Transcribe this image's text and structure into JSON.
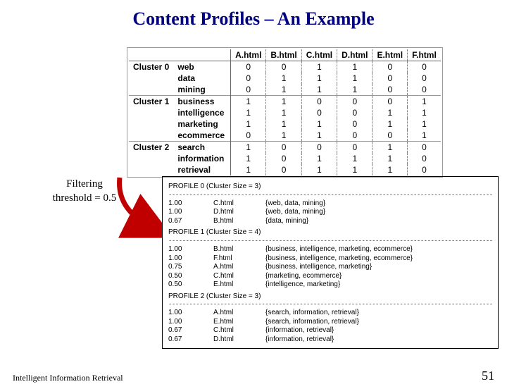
{
  "title": "Content Profiles – An Example",
  "filter_caption_line1": "Filtering",
  "filter_caption_line2": "threshold = 0.5",
  "footer_left": "Intelligent Information Retrieval",
  "footer_right": "51",
  "chart_data": {
    "type": "table",
    "columns": [
      "A.html",
      "B.html",
      "C.html",
      "D.html",
      "E.html",
      "F.html"
    ],
    "clusters": [
      {
        "label": "Cluster 0",
        "rows": [
          {
            "term": "web",
            "values": [
              0,
              0,
              1,
              1,
              0,
              0
            ]
          },
          {
            "term": "data",
            "values": [
              0,
              1,
              1,
              1,
              0,
              0
            ]
          },
          {
            "term": "mining",
            "values": [
              0,
              1,
              1,
              1,
              0,
              0
            ]
          }
        ]
      },
      {
        "label": "Cluster 1",
        "rows": [
          {
            "term": "business",
            "values": [
              1,
              1,
              0,
              0,
              0,
              1
            ]
          },
          {
            "term": "intelligence",
            "values": [
              1,
              1,
              0,
              0,
              1,
              1
            ]
          },
          {
            "term": "marketing",
            "values": [
              1,
              1,
              1,
              0,
              1,
              1
            ]
          },
          {
            "term": "ecommerce",
            "values": [
              0,
              1,
              1,
              0,
              0,
              1
            ]
          }
        ]
      },
      {
        "label": "Cluster 2",
        "rows": [
          {
            "term": "search",
            "values": [
              1,
              0,
              0,
              0,
              1,
              0
            ]
          },
          {
            "term": "information",
            "values": [
              1,
              0,
              1,
              1,
              1,
              0
            ]
          },
          {
            "term": "retrieval",
            "values": [
              1,
              0,
              1,
              1,
              1,
              0
            ]
          }
        ]
      }
    ]
  },
  "profiles": [
    {
      "header": "PROFILE 0 (Cluster Size = 3)",
      "rows": [
        {
          "score": "1.00",
          "file": "C.html",
          "terms": "{web, data, mining}"
        },
        {
          "score": "1.00",
          "file": "D.html",
          "terms": "{web, data, mining}"
        },
        {
          "score": "0.67",
          "file": "B.html",
          "terms": "{data, mining}"
        }
      ]
    },
    {
      "header": "PROFILE 1 (Cluster Size = 4)",
      "rows": [
        {
          "score": "1.00",
          "file": "B.html",
          "terms": "{business, intelligence, marketing, ecommerce}"
        },
        {
          "score": "1.00",
          "file": "F.html",
          "terms": "{business, intelligence, marketing, ecommerce}"
        },
        {
          "score": "0.75",
          "file": "A.html",
          "terms": "{business, intelligence, marketing}"
        },
        {
          "score": "0.50",
          "file": "C.html",
          "terms": "{marketing, ecommerce}"
        },
        {
          "score": "0.50",
          "file": "E.html",
          "terms": "{intelligence, marketing}"
        }
      ]
    },
    {
      "header": "PROFILE 2 (Cluster Size = 3)",
      "rows": [
        {
          "score": "1.00",
          "file": "A.html",
          "terms": "{search, information, retrieval}"
        },
        {
          "score": "1.00",
          "file": "E.html",
          "terms": "{search, information, retrieval}"
        },
        {
          "score": "0.67",
          "file": "C.html",
          "terms": "{information, retrieval}"
        },
        {
          "score": "0.67",
          "file": "D.html",
          "terms": "{information, retrieval}"
        }
      ]
    }
  ],
  "dashes": "--------------------------------------------------------------------------------------------------"
}
